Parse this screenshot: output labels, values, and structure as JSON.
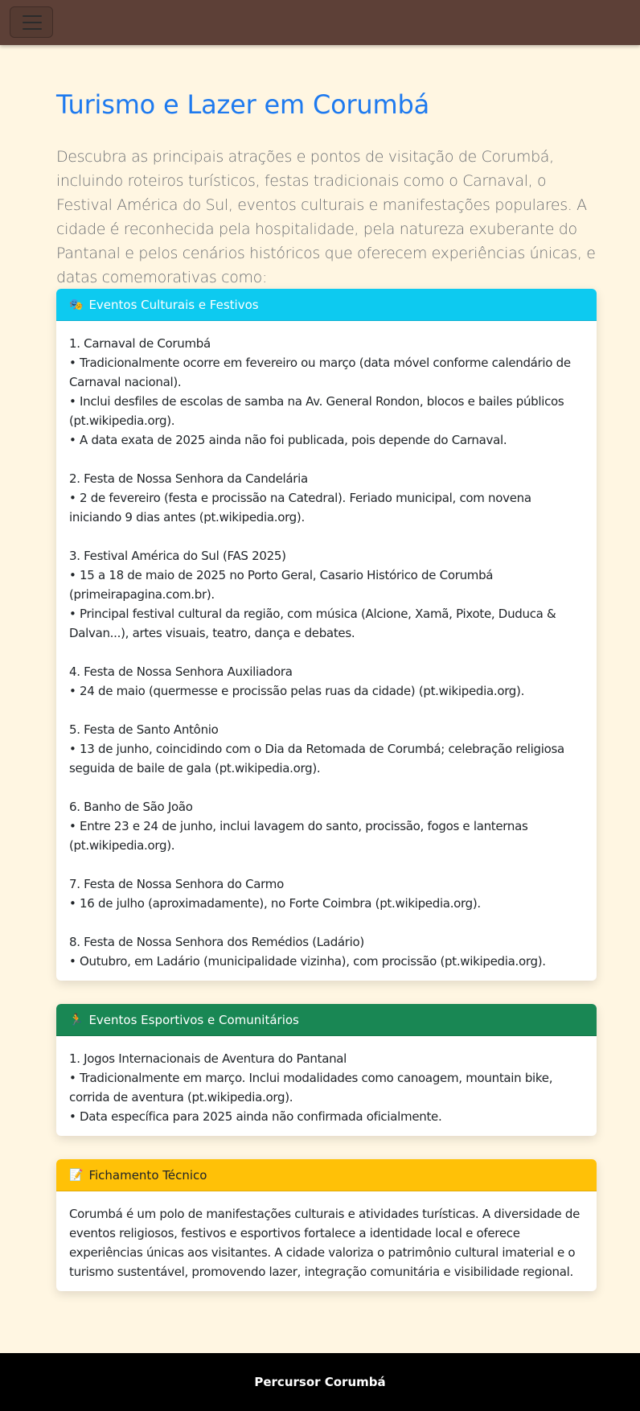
{
  "navbar": {
    "toggle_icon": "hamburger-menu-icon"
  },
  "page": {
    "title": "Turismo e Lazer em Corumbá",
    "lead": "Descubra as principais atrações e pontos de visitação de Corumbá, incluindo roteiros turísticos, festas tradicionais como o Carnaval, o Festival América do Sul, eventos culturais e manifestações populares. A cidade é reconhecida pela hospitalidade, pela natureza exuberante do Pantanal e pelos cenários históricos que oferecem experiências únicas, e datas comemorativas como:"
  },
  "colors": {
    "navbar": "#5d4037",
    "background": "#fff6e2",
    "title": "#1e7aef",
    "cultural_header": "#0dcaf0",
    "sport_header": "#198754",
    "tech_header": "#ffc107",
    "footer": "#000000"
  },
  "cards": {
    "cultural": {
      "icon": "🎭",
      "title": "Eventos Culturais e Festivos",
      "items": [
        {
          "heading": "1. Carnaval de Corumbá",
          "lines": [
            "• Tradicionalmente ocorre em fevereiro ou março (data móvel conforme calendário de Carnaval nacional).",
            "• Inclui desfiles de escolas de samba na Av. General Rondon, blocos e bailes públicos (pt.wikipedia.org).",
            "• A data exata de 2025 ainda não foi publicada, pois depende do Carnaval."
          ]
        },
        {
          "heading": "2. Festa de Nossa Senhora da Candelária",
          "lines": [
            "• 2 de fevereiro (festa e procissão na Catedral). Feriado municipal, com novena iniciando 9 dias antes (pt.wikipedia.org)."
          ]
        },
        {
          "heading": "3. Festival América do Sul (FAS 2025)",
          "lines": [
            "• 15 a 18 de maio de 2025 no Porto Geral, Casario Histórico de Corumbá (primeirapagina.com.br).",
            "• Principal festival cultural da região, com música (Alcione, Xamã, Pixote, Duduca & Dalvan...), artes visuais, teatro, dança e debates."
          ]
        },
        {
          "heading": "4. Festa de Nossa Senhora Auxiliadora",
          "lines": [
            "• 24 de maio (quermesse e procissão pelas ruas da cidade) (pt.wikipedia.org)."
          ]
        },
        {
          "heading": "5. Festa de Santo Antônio",
          "lines": [
            "• 13 de junho, coincidindo com o Dia da Retomada de Corumbá; celebração religiosa seguida de baile de gala (pt.wikipedia.org)."
          ]
        },
        {
          "heading": "6. Banho de São João",
          "lines": [
            "• Entre 23 e 24 de junho, inclui lavagem do santo, procissão, fogos e lanternas (pt.wikipedia.org)."
          ]
        },
        {
          "heading": "7. Festa de Nossa Senhora do Carmo",
          "lines": [
            "• 16 de julho (aproximadamente), no Forte Coimbra (pt.wikipedia.org)."
          ]
        },
        {
          "heading": "8. Festa de Nossa Senhora dos Remédios (Ladário)",
          "lines": [
            "• Outubro, em Ladário (municipalidade vizinha), com procissão (pt.wikipedia.org)."
          ]
        }
      ]
    },
    "sport": {
      "icon": "🏃",
      "title": "Eventos Esportivos e Comunitários",
      "items": [
        {
          "heading": "1. Jogos Internacionais de Aventura do Pantanal",
          "lines": [
            "• Tradicionalmente em março. Inclui modalidades como canoagem, mountain bike, corrida de aventura (pt.wikipedia.org).",
            "• Data específica para 2025 ainda não confirmada oficialmente."
          ]
        }
      ]
    },
    "tech": {
      "icon": "📝",
      "title": "Fichamento Técnico",
      "text": "Corumbá é um polo de manifestações culturais e atividades turísticas. A diversidade de eventos religiosos, festivos e esportivos fortalece a identidade local e oferece experiências únicas aos visitantes. A cidade valoriza o patrimônio cultural imaterial e o turismo sustentável, promovendo lazer, integração comunitária e visibilidade regional."
    }
  },
  "footer": {
    "text": "Percursor Corumbá"
  }
}
